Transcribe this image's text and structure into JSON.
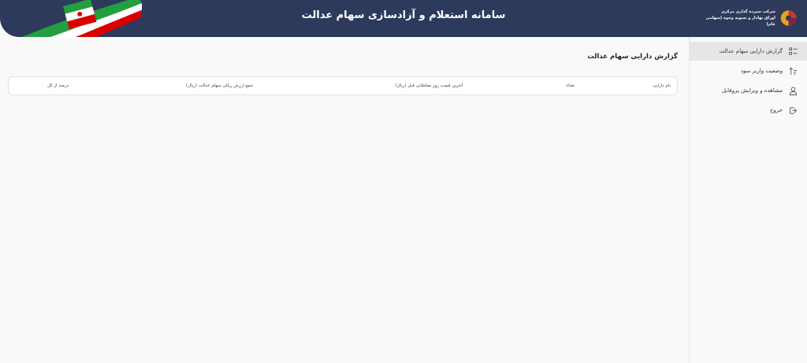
{
  "header": {
    "title": "سامانه استعلام و آزادسازی سهام عدالت",
    "logo_text_line1": "شرکت سپرده گذاری مرکزی",
    "logo_text_line2": "اوراق بهادار و تسویه وجوه (سهامی عام)",
    "flag_colors": {
      "green": "#239f40",
      "white": "#ffffff",
      "red": "#da0000"
    }
  },
  "sidebar": {
    "items": [
      {
        "label": "گزارش دارایی سهام عدالت",
        "icon": "list-check-icon",
        "active": true
      },
      {
        "label": "وضعیت واریز سود",
        "icon": "sort-up-icon",
        "active": false
      },
      {
        "label": "مشاهده و ویرایش پروفایل",
        "icon": "user-icon",
        "active": false
      },
      {
        "label": "خروج",
        "icon": "logout-icon",
        "active": false
      }
    ]
  },
  "main": {
    "page_title": "گزارش دارایی سهام عدالت",
    "table": {
      "columns": [
        "نام دارایی",
        "تعداد",
        "آخرین قیمت روز معاملاتی قبل (ریال)",
        "جمع ارزش ریالی سهام عدالت (ریال)",
        "درصد از کل"
      ]
    }
  },
  "colors": {
    "header_bg": "#2e3a5c",
    "page_bg": "#f9f9f9",
    "active_item_bg": "#e6e6e8"
  }
}
